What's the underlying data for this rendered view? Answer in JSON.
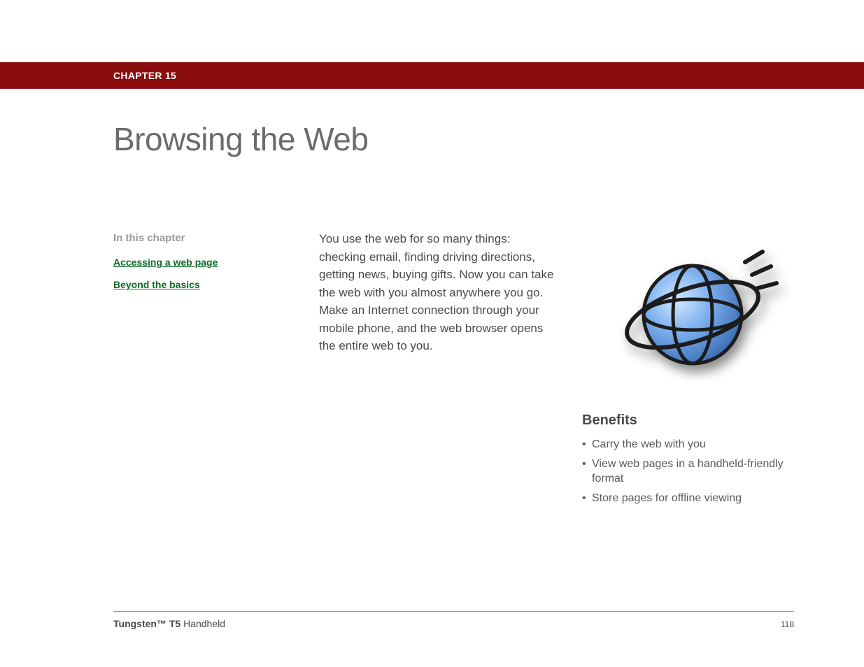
{
  "chapter": {
    "label": "CHAPTER 15"
  },
  "title": "Browsing the Web",
  "sidebar": {
    "heading": "In this chapter",
    "links": [
      "Accessing a web page",
      "Beyond the basics"
    ]
  },
  "intro": "You use the web for so many things: checking email, finding driving directions, getting news, buying gifts. Now you can take the web with you almost anywhere you go. Make an Internet connection through your mobile phone, and the web browser opens the entire web to you.",
  "benefits": {
    "heading": "Benefits",
    "items": [
      "Carry the web with you",
      "View web pages in a handheld-friendly format",
      "Store pages for offline viewing"
    ]
  },
  "footer": {
    "product_bold": "Tungsten™ T5",
    "product_rest": " Handheld",
    "page": "118"
  }
}
